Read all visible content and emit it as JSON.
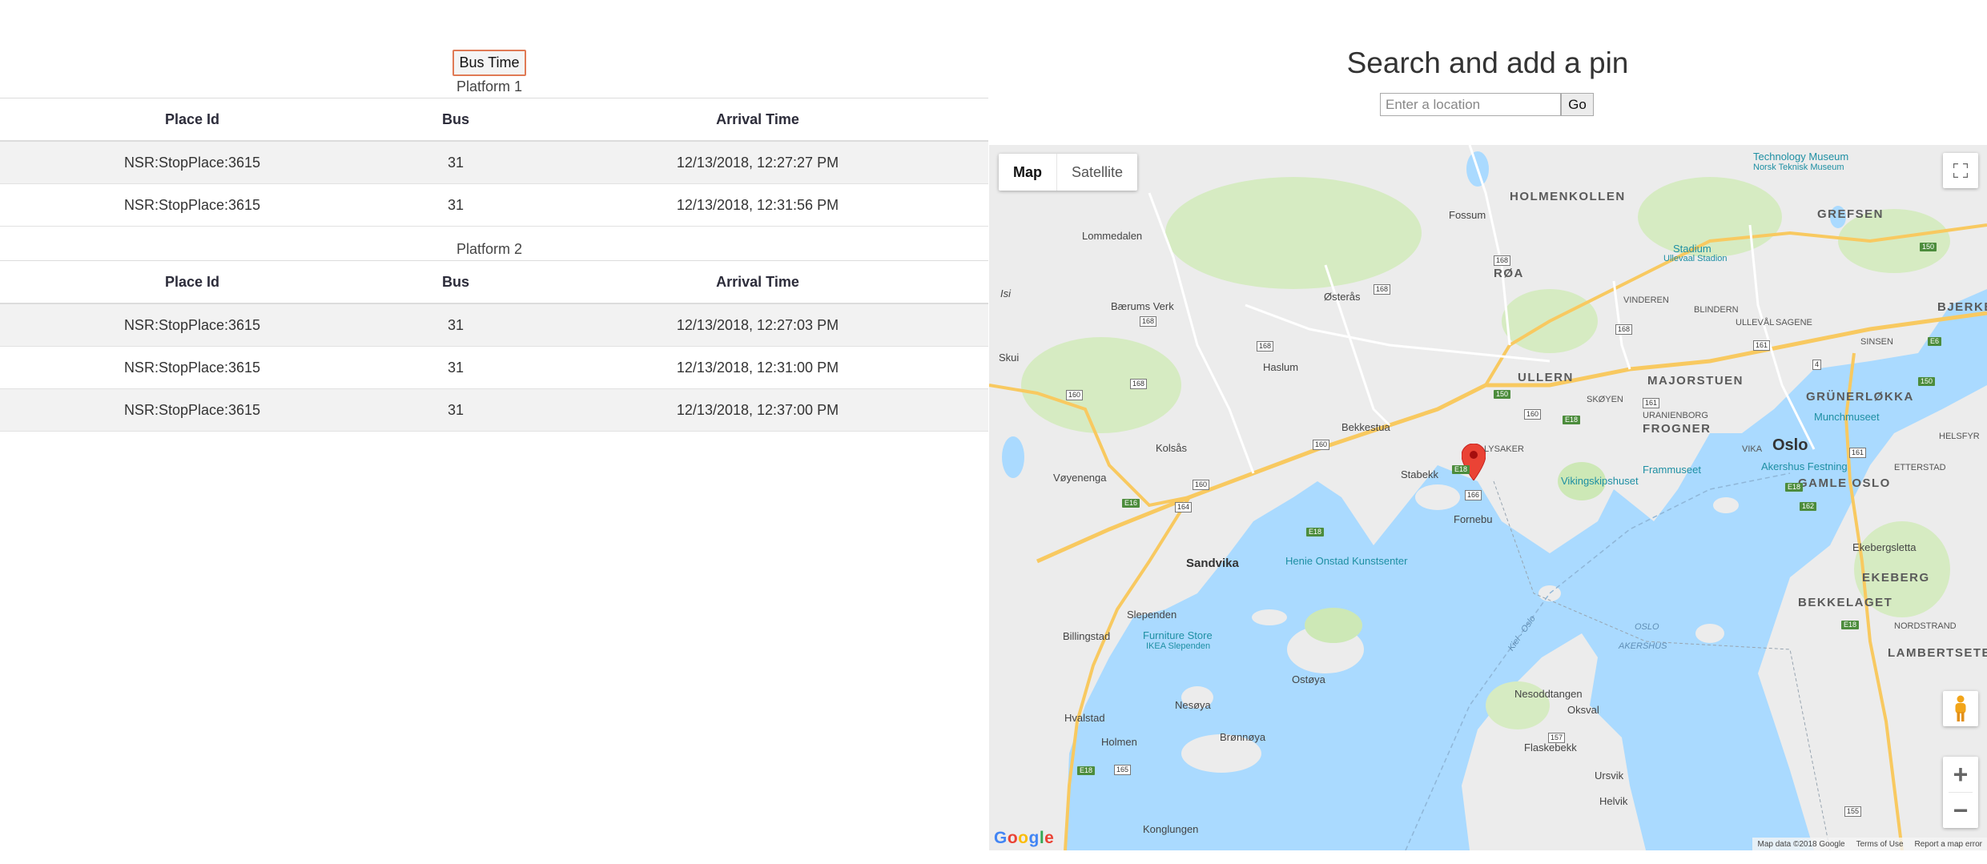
{
  "bus_button_label": "Bus Time",
  "columns": {
    "place": "Place Id",
    "bus": "Bus",
    "arrival": "Arrival Time"
  },
  "platform1": {
    "label": "Platform 1",
    "rows": [
      {
        "place": "NSR:StopPlace:3615",
        "bus": "31",
        "arrival": "12/13/2018, 12:27:27 PM"
      },
      {
        "place": "NSR:StopPlace:3615",
        "bus": "31",
        "arrival": "12/13/2018, 12:31:56 PM"
      }
    ]
  },
  "platform2": {
    "label": "Platform 2",
    "rows": [
      {
        "place": "NSR:StopPlace:3615",
        "bus": "31",
        "arrival": "12/13/2018, 12:27:03 PM"
      },
      {
        "place": "NSR:StopPlace:3615",
        "bus": "31",
        "arrival": "12/13/2018, 12:31:00 PM"
      },
      {
        "place": "NSR:StopPlace:3615",
        "bus": "31",
        "arrival": "12/13/2018, 12:37:00 PM"
      }
    ]
  },
  "search": {
    "title": "Search and add a pin",
    "placeholder": "Enter a location",
    "go_label": "Go"
  },
  "map": {
    "type_map": "Map",
    "type_satellite": "Satellite",
    "google_logo": "Google",
    "attribution": {
      "map_data": "Map data ©2018 Google",
      "terms": "Terms of Use",
      "report": "Report a map error"
    },
    "icons": {
      "fullscreen": "fullscreen-icon",
      "pegman": "pegman-icon",
      "zoom_in": "plus-icon",
      "zoom_out": "minus-icon",
      "pin": "map-pin-icon"
    },
    "labels": {
      "holmenkollen": "HOLMENKOLLEN",
      "grefsen": "GREFSEN",
      "bjerke": "BJERKE",
      "roa": "RØA",
      "ullern": "ULLERN",
      "majorstuen": "MAJORSTUEN",
      "grunerlokka": "GRÜNERLØKKA",
      "frogner": "FROGNER",
      "oslo": "Oslo",
      "gamle_oslo": "GAMLE OSLO",
      "ekeberg": "EKEBERG",
      "bekkelaget": "BEKKELAGET",
      "lambertseter": "LAMBERTSETER",
      "technical_museum_1": "Technology Museum",
      "technical_museum_2": "Norsk Teknisk Museum",
      "fossum": "Fossum",
      "lommedalen": "Lommedalen",
      "stadium_1": "Stadium",
      "stadium_2": "Ullevaal Stadion",
      "vinderen": "VINDEREN",
      "blindern": "BLINDERN",
      "ulleval": "ULLEVÅL",
      "sagene": "SAGENE",
      "sinsen": "SINSEN",
      "isi": "Isi",
      "baerums_verk": "Bærums Verk",
      "osteras": "Østerås",
      "skui": "Skui",
      "haslum": "Haslum",
      "skoyen": "SKØYEN",
      "uranienborg": "URANIENBORG",
      "munchmuseet": "Munchmuseet",
      "helsfyr": "HELSFYR",
      "bekkestua": "Bekkestua",
      "kolsas": "Kolsås",
      "lysaker": "LYSAKER",
      "vika": "VIKA",
      "ettersted": "ETTERSTAD",
      "voyenenga": "Vøyenenga",
      "stabekk": "Stabekk",
      "frammuseet": "Frammuseet",
      "vikingskipshuset": "Vikingskipshuset",
      "akershus_festning": "Akershus Festning",
      "fornebu": "Fornebu",
      "sandvika": "Sandvika",
      "henie_onstad": "Henie Onstad Kunstsenter",
      "ekebergsletta": "Ekebergsletta",
      "slependen": "Slependen",
      "billingstad": "Billingstad",
      "furniture_store": "Furniture Store",
      "ikea": "IKEA Slependen",
      "nordstrand": "NORDSTRAND",
      "ostoya": "Ostøya",
      "nesoddtangen": "Nesoddtangen",
      "nesoya": "Nesøya",
      "oksval": "Oksval",
      "hvalstad": "Hvalstad",
      "bronnoya": "Brønnøya",
      "flaskebekk": "Flaskebekk",
      "holmen": "Holmen",
      "ursvik": "Ursvik",
      "helvik": "Helvik",
      "konglungen": "Konglungen",
      "oslo_akershus_1": "OSLO",
      "oslo_akershus_2": "AKERSHUS",
      "kiel_oslo": "Kiel - Oslo"
    },
    "roads": {
      "r150": "150",
      "r168": "168",
      "r160": "160",
      "r161": "161",
      "r4": "4",
      "r162": "162",
      "r164": "164",
      "r166": "166",
      "r157": "157",
      "r165": "165",
      "r155": "155",
      "e18": "E18",
      "e16": "E16",
      "e6": "E6"
    },
    "colors": {
      "water": "#aadaff",
      "land": "#ececec",
      "park": "#cde8b6",
      "pin": "#ea4335"
    }
  }
}
